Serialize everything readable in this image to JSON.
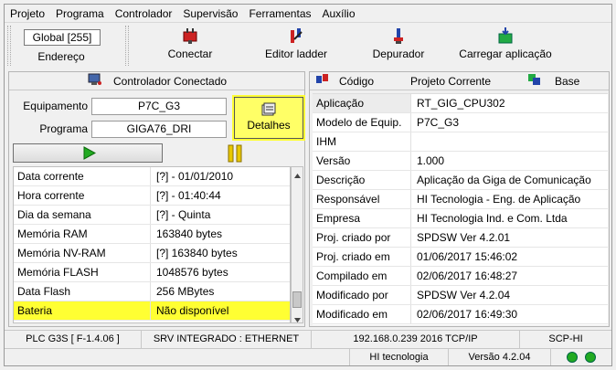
{
  "menu": [
    "Projeto",
    "Programa",
    "Controlador",
    "Supervisão",
    "Ferramentas",
    "Auxílio"
  ],
  "toolbar": {
    "global": "Global [255]",
    "endereco": "Endereço",
    "conectar": "Conectar",
    "editor_ladder": "Editor ladder",
    "depurador": "Depurador",
    "carregar": "Carregar aplicação"
  },
  "left": {
    "header": "Controlador Conectado",
    "equipamento_label": "Equipamento",
    "equipamento_value": "P7C_G3",
    "programa_label": "Programa",
    "programa_value": "GIGA76_DRI",
    "detalhes": "Detalhes",
    "rows": [
      {
        "k": "Data corrente",
        "v": "[?] - 01/01/2010"
      },
      {
        "k": "Hora corrente",
        "v": "[?] - 01:40:44"
      },
      {
        "k": "Dia da semana",
        "v": "[?] - Quinta"
      },
      {
        "k": "Memória RAM",
        "v": "163840 bytes"
      },
      {
        "k": "Memória NV-RAM",
        "v": "[?] 163840 bytes"
      },
      {
        "k": "Memória FLASH",
        "v": "1048576 bytes"
      },
      {
        "k": "Data Flash",
        "v": "256 MBytes"
      },
      {
        "k": "Bateria",
        "v": "Não disponível"
      }
    ]
  },
  "right": {
    "col_codigo": "Código",
    "col_projeto": "Projeto Corrente",
    "col_base": "Base",
    "rows": [
      {
        "k": "Aplicação",
        "v": "RT_GIG_CPU302"
      },
      {
        "k": "Modelo de Equip.",
        "v": "P7C_G3"
      },
      {
        "k": "IHM",
        "v": ""
      },
      {
        "k": "Versão",
        "v": "1.000"
      },
      {
        "k": "Descrição",
        "v": "Aplicação da Giga de Comunicação"
      },
      {
        "k": "Responsável",
        "v": "HI Tecnologia - Eng. de Aplicação"
      },
      {
        "k": "Empresa",
        "v": "HI Tecnologia Ind. e Com. Ltda"
      },
      {
        "k": "Proj. criado por",
        "v": "SPDSW Ver 4.2.01"
      },
      {
        "k": "Proj. criado em",
        "v": "01/06/2017 15:46:02"
      },
      {
        "k": "Compilado em",
        "v": "02/06/2017 16:48:27"
      },
      {
        "k": "Modificado por",
        "v": "SPDSW Ver 4.2.04"
      },
      {
        "k": "Modificado em",
        "v": "02/06/2017 16:49:30"
      }
    ]
  },
  "status": {
    "plc": "PLC G3S [ F-1.4.06 ]",
    "srv": "SRV INTEGRADO : ETHERNET",
    "ip": "192.168.0.239 2016 TCP/IP",
    "scp": "SCP-HI",
    "company": "HI tecnologia",
    "version": "Versão 4.2.04"
  },
  "colors": {
    "highlight": "#ffff33",
    "led": "#22aa22"
  }
}
